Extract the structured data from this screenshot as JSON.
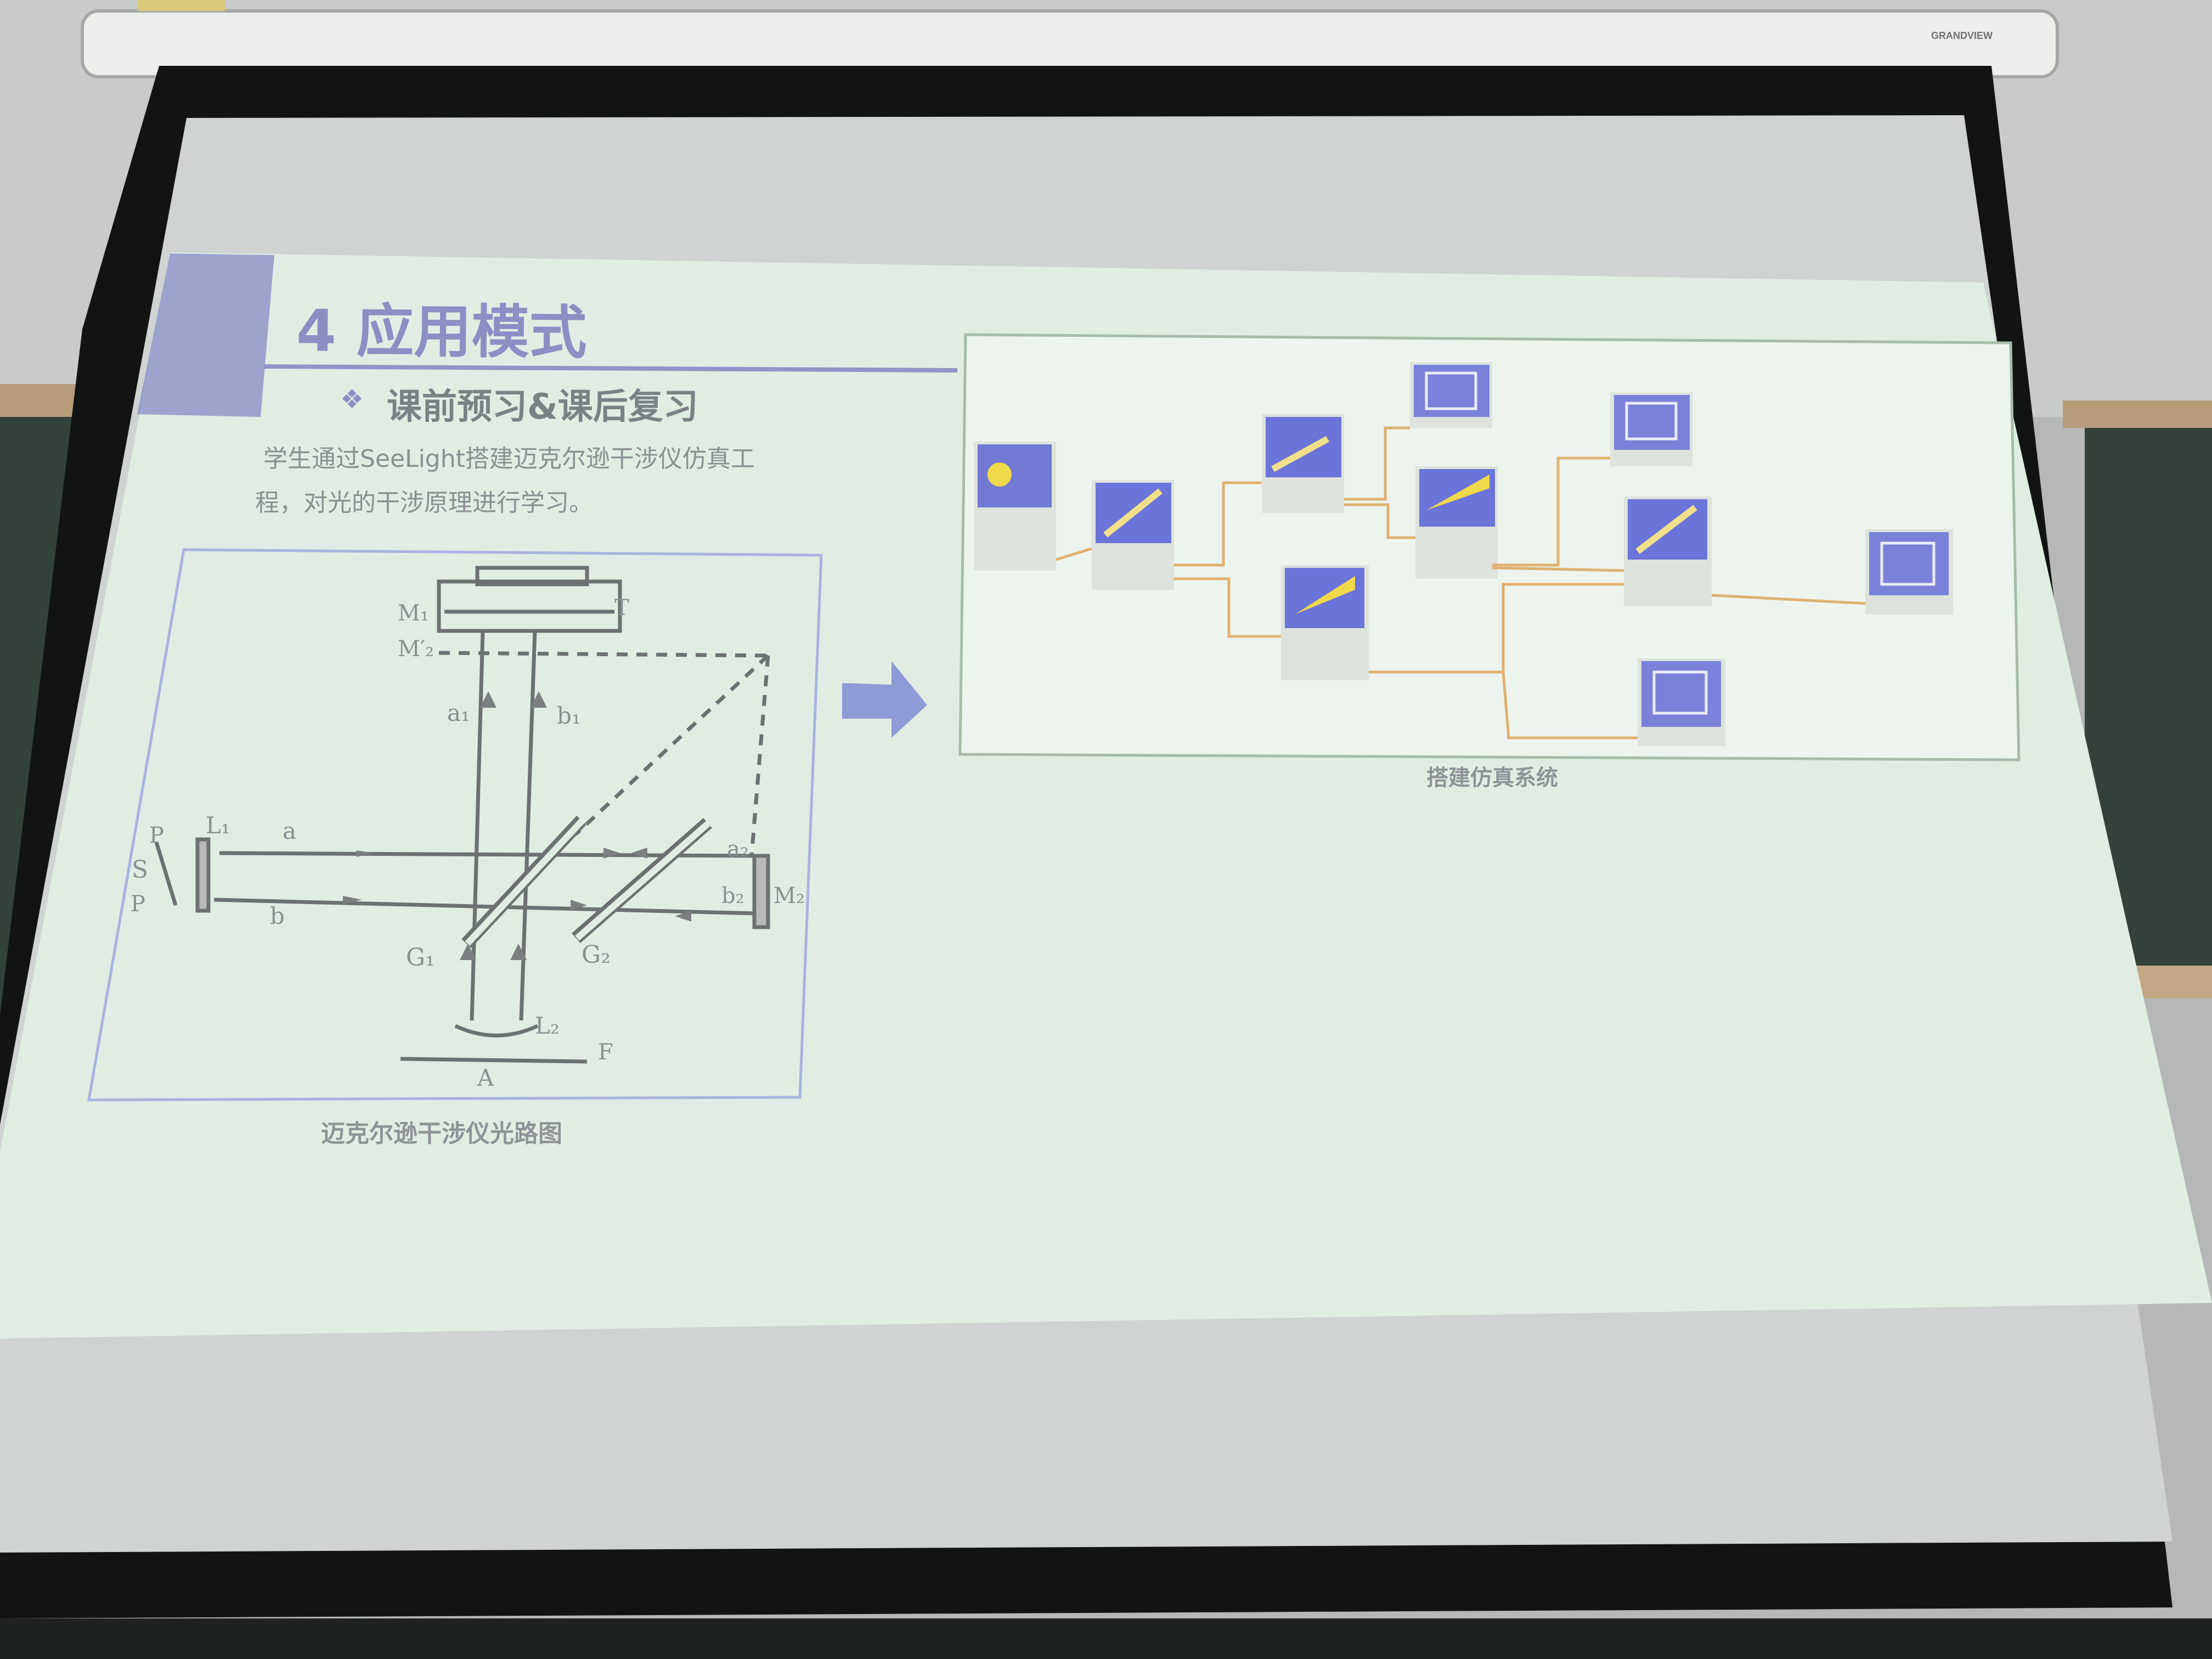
{
  "projector": {
    "brand": "GRANDVIEW"
  },
  "slide": {
    "title": "4 应用模式",
    "bullet": "课前预习&课后复习",
    "body_line1": "学生通过SeeLight搭建迈克尔逊干涉仪仿真工",
    "body_line2": "程，对光的干涉原理进行学习。",
    "left_caption": "迈克尔逊干涉仪光路图",
    "right_caption": "搭建仿真系统"
  },
  "optics_labels": {
    "M1": "M₁",
    "M2prime": "M′₂",
    "T": "T",
    "a1": "a₁",
    "b1": "b₁",
    "P_top": "P",
    "S": "S",
    "P_bottom": "P",
    "L1": "L₁",
    "a": "a",
    "b": "b",
    "a2": "a₂",
    "b2": "b₂",
    "M2": "M₂",
    "G1": "G₁",
    "G2": "G₂",
    "L2": "L₂",
    "F": "F",
    "A": "A"
  },
  "colors": {
    "slide_bg": "#e3efe5",
    "title": "#8a8fc4",
    "accent_band": "#8f95c9",
    "node_icon": "#6b74d8",
    "wire": "#e0b070",
    "arrow": "#8d9bd6"
  }
}
